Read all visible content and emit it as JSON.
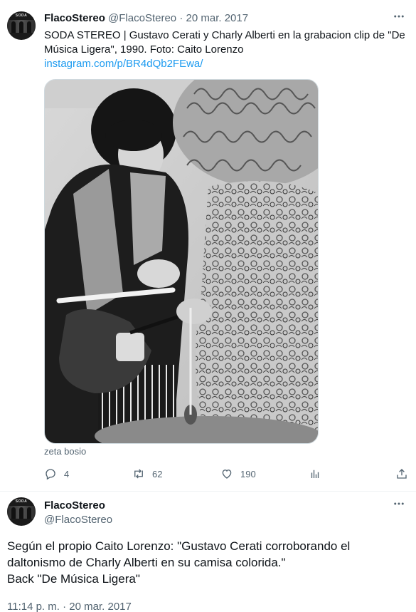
{
  "tweet1": {
    "display_name": "FlacoStereo",
    "handle": "@FlacoStereo",
    "separator": "·",
    "date": "20 mar. 2017",
    "text": "SODA STEREO | Gustavo Cerati y Charly Alberti en la grabacion clip de \"De Música Ligera\", 1990. Foto: Caito Lorenzo",
    "link": "instagram.com/p/BR4dQb2FEwa/",
    "caption": "zeta bosio",
    "stats": {
      "replies": "4",
      "retweets": "62",
      "likes": "190"
    }
  },
  "tweet2": {
    "display_name": "FlacoStereo",
    "handle": "@FlacoStereo",
    "lines": [
      "Según el propio Caito Lorenzo: \"Gustavo Cerati corroborando el",
      "daltonismo de Charly Alberti en su camisa colorida.\"",
      "Back \"De Música Ligera\""
    ],
    "time": "11:14 p. m.",
    "separator": "·",
    "date": "20 mar. 2017"
  },
  "icons": {
    "reply": "reply-icon",
    "retweet": "retweet-icon",
    "like": "heart-icon",
    "views": "analytics-icon",
    "share": "share-icon",
    "more": "more-icon"
  },
  "colors": {
    "link": "#1d9bf0",
    "secondary_text": "#536471",
    "primary_text": "#0f1419"
  }
}
